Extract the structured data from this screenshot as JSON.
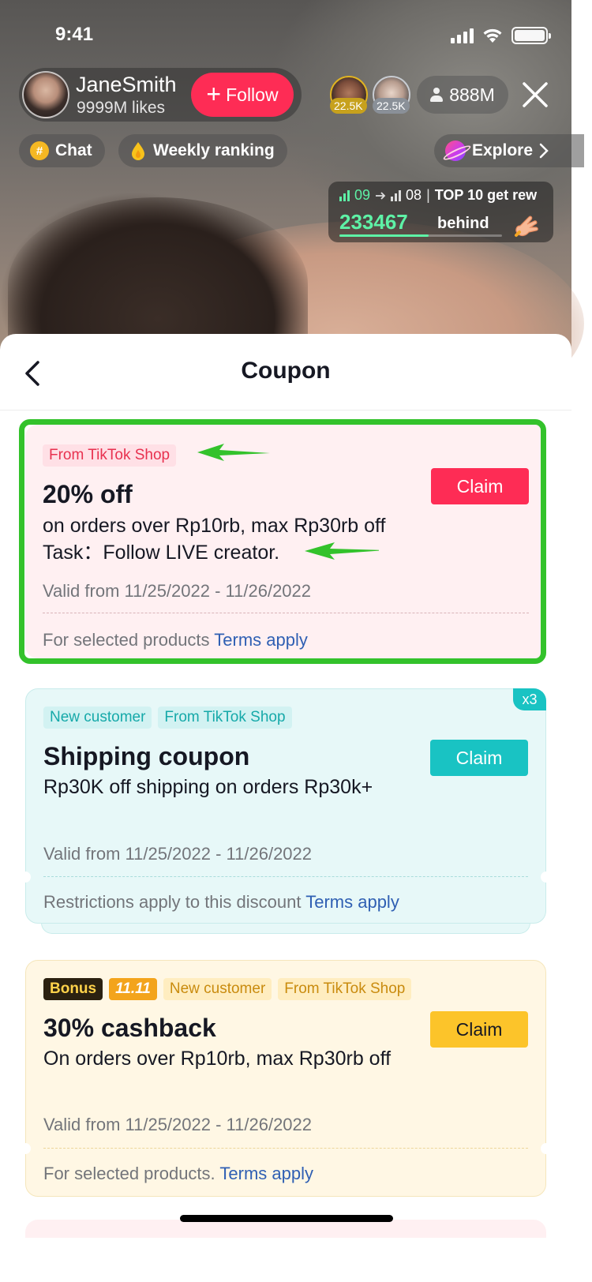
{
  "status_bar": {
    "time": "9:41"
  },
  "live": {
    "host": {
      "name": "JaneSmith",
      "likes": "9999M likes",
      "follow_label": "Follow"
    },
    "viewers": [
      {
        "badge": "22.5K"
      },
      {
        "badge": "22.5K"
      }
    ],
    "viewer_count": "888M",
    "chips": {
      "chat": "Chat",
      "ranking": "Weekly ranking",
      "explore": "Explore"
    },
    "ranking": {
      "current_rank": "09",
      "next_rank": "08",
      "top_label": "TOP 10 get rew",
      "points": "233467",
      "behind_label": "behind",
      "progress": 0.55
    }
  },
  "sheet": {
    "title": "Coupon",
    "coupons": [
      {
        "tags": [
          "From TikTok Shop"
        ],
        "title": "20% off",
        "description": "on orders over Rp10rb, max Rp30rb off",
        "task": "Task：Follow LIVE creator.",
        "valid": "Valid from 11/25/2022 - 11/26/2022",
        "footer": "For selected products",
        "terms": "Terms apply",
        "claim": "Claim",
        "accent": "#fe2c55"
      },
      {
        "tags": [
          "New customer",
          "From TikTok Shop"
        ],
        "title": "Shipping coupon",
        "description": "Rp30K off shipping on orders Rp30k+",
        "valid": "Valid from 11/25/2022 - 11/26/2022",
        "footer": "Restrictions apply to this discount",
        "terms": "Terms apply",
        "claim": "Claim",
        "multiplier": "x3",
        "accent": "#19c3c3"
      },
      {
        "tags": [
          "Bonus",
          "11.11",
          "New customer",
          "From TikTok Shop"
        ],
        "title": "30% cashback",
        "description": "On orders over Rp10rb, max Rp30rb off",
        "valid": "Valid from 11/25/2022 - 11/26/2022",
        "footer": "For selected products.",
        "terms": "Terms apply",
        "claim": "Claim",
        "accent": "#fcc42a"
      }
    ]
  },
  "annotation_color": "#33c22b",
  "icons": [
    "signal-icon",
    "wifi-icon",
    "battery-icon",
    "plus-icon",
    "person-icon",
    "close-icon",
    "hash-icon",
    "flame-drop-icon",
    "planet-icon",
    "chevron-right-icon",
    "bar-chart-icon",
    "arrow-right-icon",
    "pointing-hand-icon",
    "back-chevron-icon",
    "green-arrow-icon"
  ]
}
